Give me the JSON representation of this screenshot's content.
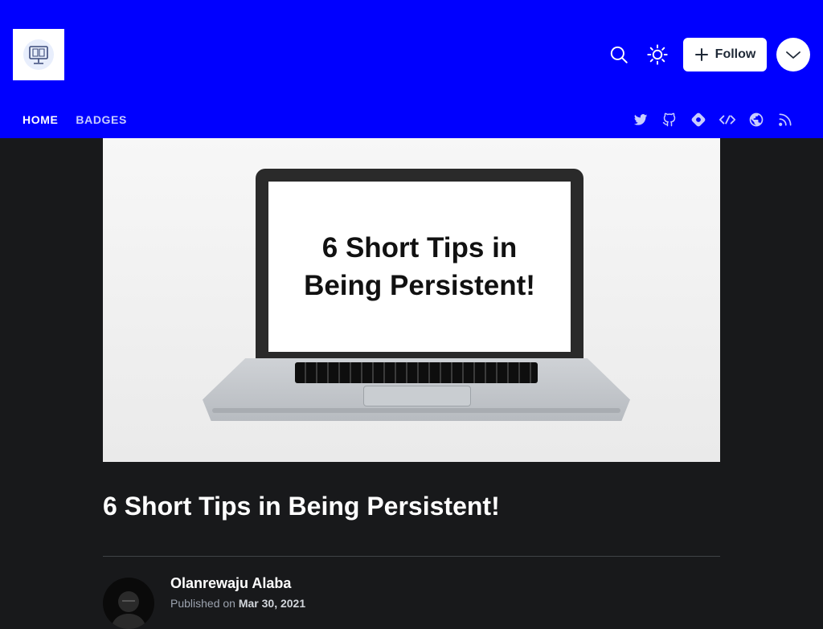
{
  "header": {
    "logo_icon": "computer-book-icon",
    "search_icon": "search-icon",
    "theme_icon": "sun-icon",
    "follow_label": "Follow",
    "menu_icon": "chevron-down-icon",
    "bg_color": "#0000ff"
  },
  "nav": {
    "items": [
      {
        "label": "HOME",
        "active": true
      },
      {
        "label": "BADGES",
        "active": false
      }
    ]
  },
  "socials": [
    "twitter-icon",
    "github-icon",
    "hashnode-icon",
    "devto-icon",
    "globe-icon",
    "rss-icon"
  ],
  "cover": {
    "text": "6 Short Tips in\nBeing Persistent!"
  },
  "post": {
    "title": "6 Short Tips in Being Persistent!",
    "author": "Olanrewaju Alaba",
    "published_prefix": "Published on",
    "date": "Mar 30, 2021"
  }
}
